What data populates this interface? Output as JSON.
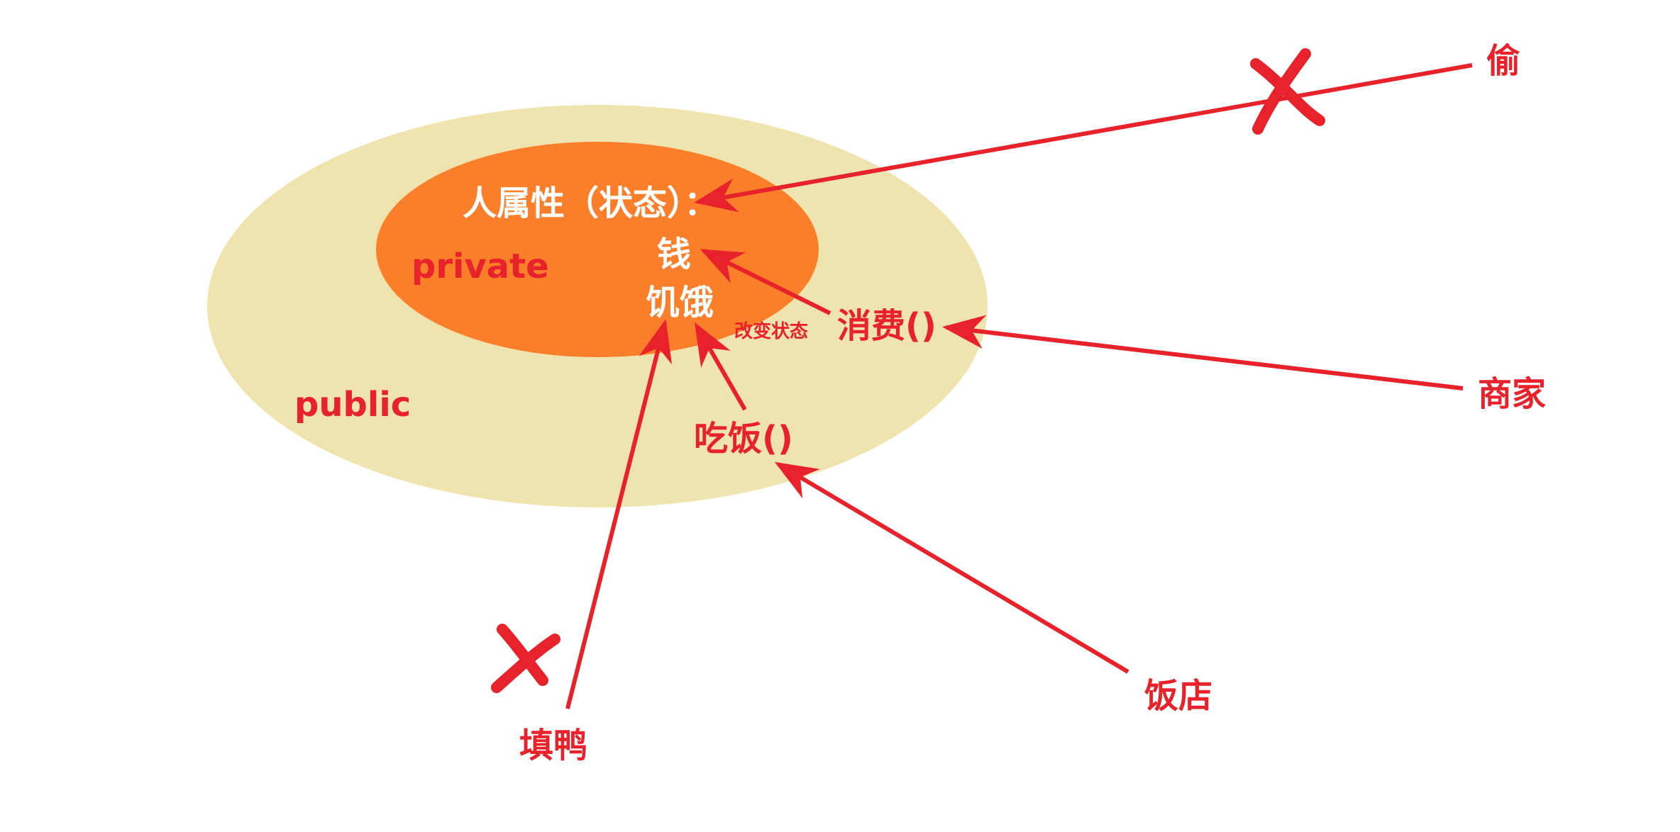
{
  "colors": {
    "public_fill": "#efe3ae",
    "private_fill": "#fb7f2a",
    "accent_red": "#e8222b",
    "inner_text": "#ffffff"
  },
  "labels": {
    "attributes_title": "人属性（状态）：",
    "money": "钱",
    "hunger": "饥饿",
    "private": "private",
    "public": "public",
    "change_state": "改变状态",
    "consume_method": "消费()",
    "eat_method": "吃饭()",
    "steal": "偷",
    "merchant": "商家",
    "restaurant": "饭店",
    "force_feed": "填鸭"
  },
  "icons": {
    "blocked_marker": "cross-icon"
  }
}
